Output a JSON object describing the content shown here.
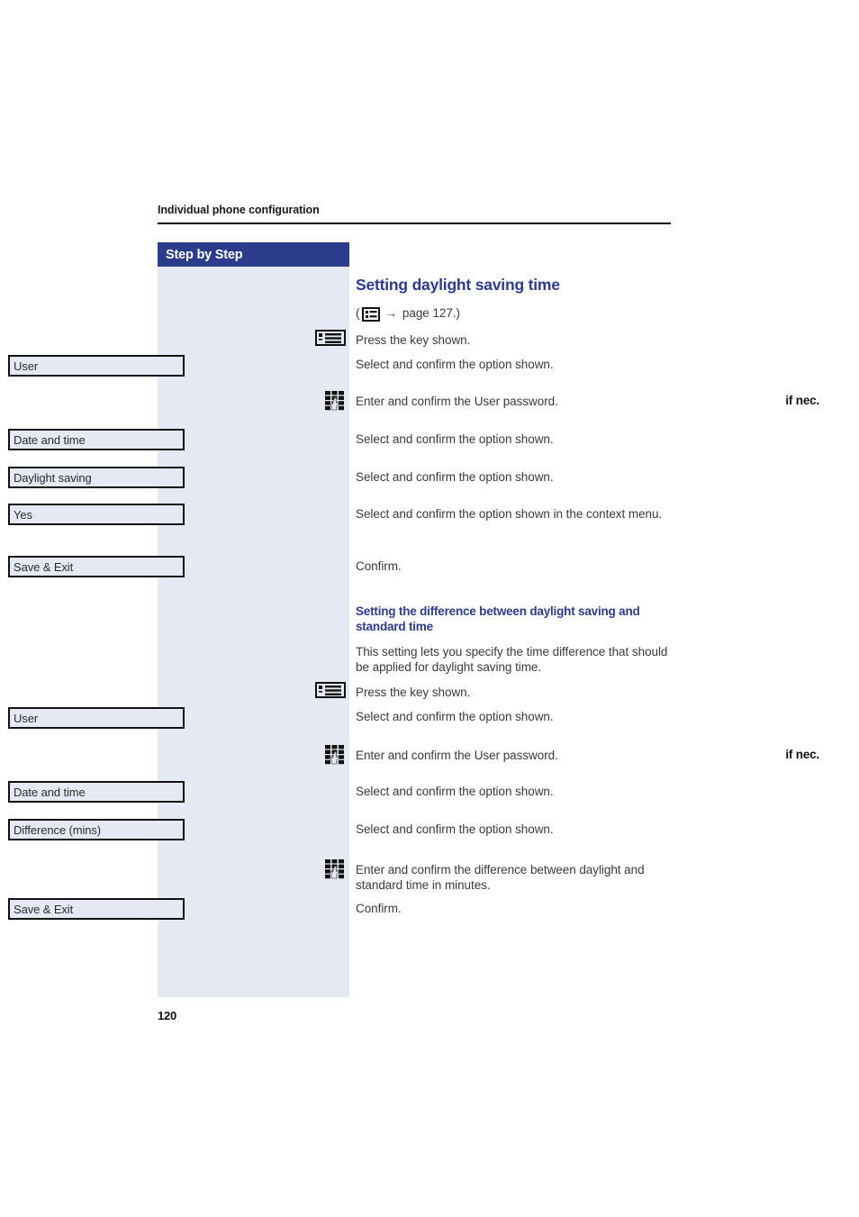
{
  "document": {
    "running_header": "Individual phone configuration",
    "folio": "120"
  },
  "sidebar": {
    "title": "Step by Step",
    "accent_color": "#2b3c8c",
    "background_color": "#e5e9f4",
    "items": [
      {
        "type": "icon",
        "name": "settings-key-icon",
        "label": ""
      },
      {
        "type": "option-box",
        "label": "User"
      },
      {
        "type": "keypad",
        "prefix": "if nec.",
        "name": "keypad-hand-icon"
      },
      {
        "type": "option-box",
        "label": "Date and time"
      },
      {
        "type": "option-box",
        "label": "Daylight saving"
      },
      {
        "type": "option-box",
        "label": "Yes"
      },
      {
        "type": "option-box",
        "label": "Save & Exit"
      },
      {
        "type": "icon",
        "name": "settings-key-icon",
        "label": ""
      },
      {
        "type": "option-box",
        "label": "User"
      },
      {
        "type": "keypad",
        "prefix": "if nec.",
        "name": "keypad-hand-icon"
      },
      {
        "type": "option-box",
        "label": "Date and time"
      },
      {
        "type": "option-box",
        "label": "Difference (mins)"
      },
      {
        "type": "keypad",
        "prefix": "",
        "name": "keypad-hand-icon"
      },
      {
        "type": "option-box",
        "label": "Save & Exit"
      }
    ]
  },
  "main": {
    "section1": {
      "heading": "Setting daylight saving time",
      "page_ref_open": "(",
      "page_ref_icon": "options-list-icon",
      "page_ref_arrow": "→",
      "page_ref_text": "page 127.)",
      "steps": [
        "Press the key shown.",
        "Select and confirm the option shown.",
        "Enter and confirm the User password.",
        "Select and confirm the option shown.",
        "Select and confirm the option shown.",
        "Select and confirm the option shown in the context menu.",
        "Confirm."
      ]
    },
    "section2": {
      "heading": "Setting the difference between daylight saving and standard time",
      "intro": "This setting lets you specify the time difference that should be applied for daylight saving time.",
      "steps": [
        "Press the key shown.",
        "Select and confirm the option shown.",
        "Enter and confirm the User password.",
        "Select and confirm the option shown.",
        "Select and confirm the option shown.",
        "Enter and confirm the difference between daylight and standard time in minutes.",
        "Confirm."
      ]
    }
  }
}
